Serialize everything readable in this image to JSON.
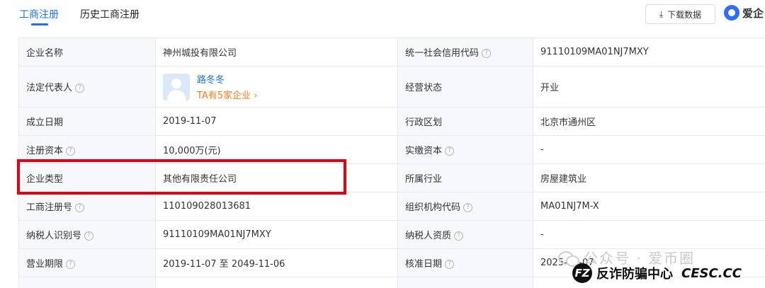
{
  "tabs": [
    {
      "label": "工商注册",
      "active": true
    },
    {
      "label": "历史工商注册",
      "active": false
    }
  ],
  "toolbar": {
    "download_icon": "download-icon",
    "download_label": "下载数据",
    "brand_label": "爱企"
  },
  "rows": [
    {
      "l1": "企业名称",
      "v1": "神州城投有限公司",
      "l2": "统一社会信用代码",
      "h2": true,
      "v2": "91110109MA01NJ7MXY"
    },
    {
      "l1": "法定代表人",
      "h1": true,
      "person": {
        "name": "路冬冬",
        "sub": "TA有5家企业 ›"
      },
      "l2": "经营状态",
      "v2": "开业"
    },
    {
      "l1": "成立日期",
      "v1": "2019-11-07",
      "l2": "行政区划",
      "v2": "北京市通州区"
    },
    {
      "l1": "注册资本",
      "h1": true,
      "v1": "10,000万(元)",
      "l2": "实缴资本",
      "h2": true,
      "v2": "-"
    },
    {
      "l1": "企业类型",
      "v1": "其他有限责任公司",
      "l2": "所属行业",
      "v2": "房屋建筑业"
    },
    {
      "l1": "工商注册号",
      "h1": true,
      "v1": "110109028013681",
      "l2": "组织机构代码",
      "h2": true,
      "v2": "MA01NJ7M-X"
    },
    {
      "l1": "纳税人识别号",
      "h1": true,
      "v1": "91110109MA01NJ7MXY",
      "l2": "纳税人资质",
      "h2": true,
      "v2": "-"
    },
    {
      "l1": "营业期限",
      "h1": true,
      "v1": "2019-11-07 至 2049-11-06",
      "l2": "核准日期",
      "h2": true,
      "v2": "2025-04-07"
    }
  ],
  "help_glyph": "?",
  "watermark": {
    "line1": "公众号 · 爱币圈",
    "fz_logo": "FZ",
    "line2": "反诈防骗中心",
    "domain": "CESC.CC"
  },
  "colors": {
    "accent": "#1a73e8",
    "highlight": "#e50012",
    "link_orange": "#ff7a1a"
  }
}
